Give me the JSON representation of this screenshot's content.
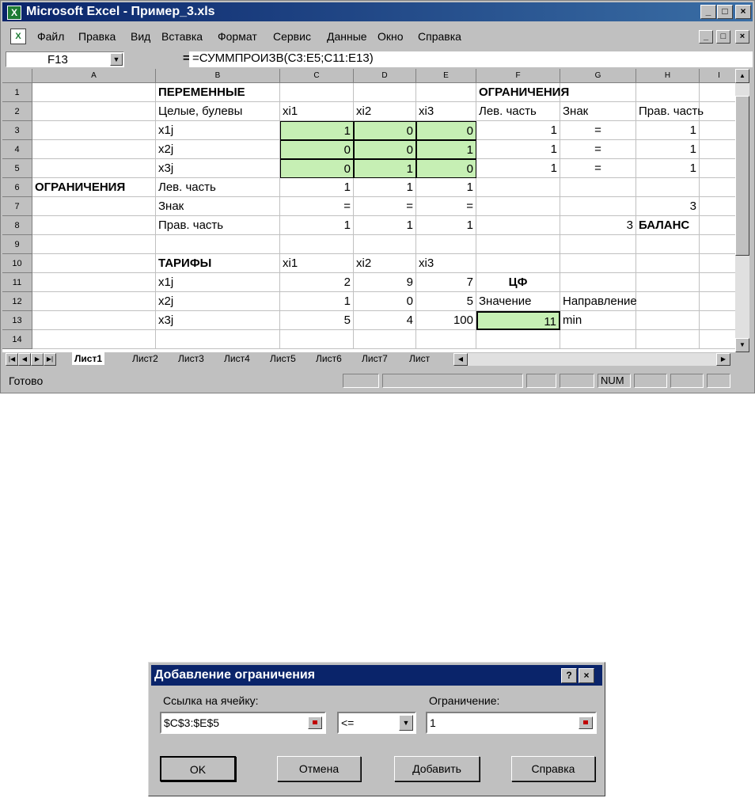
{
  "window": {
    "title": "Microsoft Excel - Пример_3.xls",
    "controls": [
      "_",
      "□",
      "×"
    ]
  },
  "menu": [
    "Файл",
    "Правка",
    "Вид",
    "Вставка",
    "Формат",
    "Сервис",
    "Данные",
    "Окно",
    "Справка"
  ],
  "formula_bar": {
    "name_box": "F13",
    "eq": "=",
    "formula": "=СУММПРОИЗВ(C3:E5;C11:E13)"
  },
  "columns": [
    "A",
    "B",
    "C",
    "D",
    "E",
    "F",
    "G",
    "H",
    "I"
  ],
  "rows": [
    "1",
    "2",
    "3",
    "4",
    "5",
    "6",
    "7",
    "8",
    "9",
    "10",
    "11",
    "12",
    "13",
    "14"
  ],
  "cells": {
    "B1": "ПЕРЕМЕННЫЕ",
    "F1": "ОГРАНИЧЕНИЯ",
    "B2": "Целые, булевы",
    "C2": "xi1",
    "D2": "xi2",
    "E2": "xi3",
    "F2": "Лев. часть",
    "G2": "Знак",
    "H2": "Прав. часть",
    "B3": "x1j",
    "C3": "1",
    "D3": "0",
    "E3": "0",
    "F3": "1",
    "G3": "=",
    "H3": "1",
    "B4": "x2j",
    "C4": "0",
    "D4": "0",
    "E4": "1",
    "F4": "1",
    "G4": "=",
    "H4": "1",
    "B5": "x3j",
    "C5": "0",
    "D5": "1",
    "E5": "0",
    "F5": "1",
    "G5": "=",
    "H5": "1",
    "A6": "ОГРАНИЧЕНИЯ",
    "B6": "Лев. часть",
    "C6": "1",
    "D6": "1",
    "E6": "1",
    "B7": "Знак",
    "C7": "=",
    "D7": "=",
    "E7": "=",
    "H7": "3",
    "B8": "Прав. часть",
    "C8": "1",
    "D8": "1",
    "E8": "1",
    "G8": "3",
    "H8": "БАЛАНС",
    "B10": "ТАРИФЫ",
    "C10": "xi1",
    "D10": "xi2",
    "E10": "xi3",
    "B11": "x1j",
    "C11": "2",
    "D11": "9",
    "E11": "7",
    "F11": "ЦФ",
    "B12": "x2j",
    "C12": "1",
    "D12": "0",
    "E12": "5",
    "F12": "Значение",
    "G12": "Направление",
    "B13": "x3j",
    "C13": "5",
    "D13": "4",
    "E13": "100",
    "F13": "11",
    "G13": "min"
  },
  "sheet_tabs": [
    "Лист1",
    "Лист2",
    "Лист3",
    "Лист4",
    "Лист5",
    "Лист6",
    "Лист7",
    "Лист"
  ],
  "status": {
    "ready": "Готово",
    "num": "NUM"
  },
  "dialog": {
    "title": "Добавление ограничения",
    "cell_ref_label": "Ссылка на ячейку:",
    "cell_ref_value": "$C$3:$E$5",
    "operator_value": "<=",
    "constraint_label": "Ограничение:",
    "constraint_value": "1",
    "buttons": {
      "ok": "OK",
      "cancel": "Отмена",
      "add": "Добавить",
      "help": "Справка"
    }
  },
  "colors": {
    "title_bar": "#0a246a",
    "highlight_cell": "#c6efb4",
    "chrome": "#c0c0c0"
  }
}
